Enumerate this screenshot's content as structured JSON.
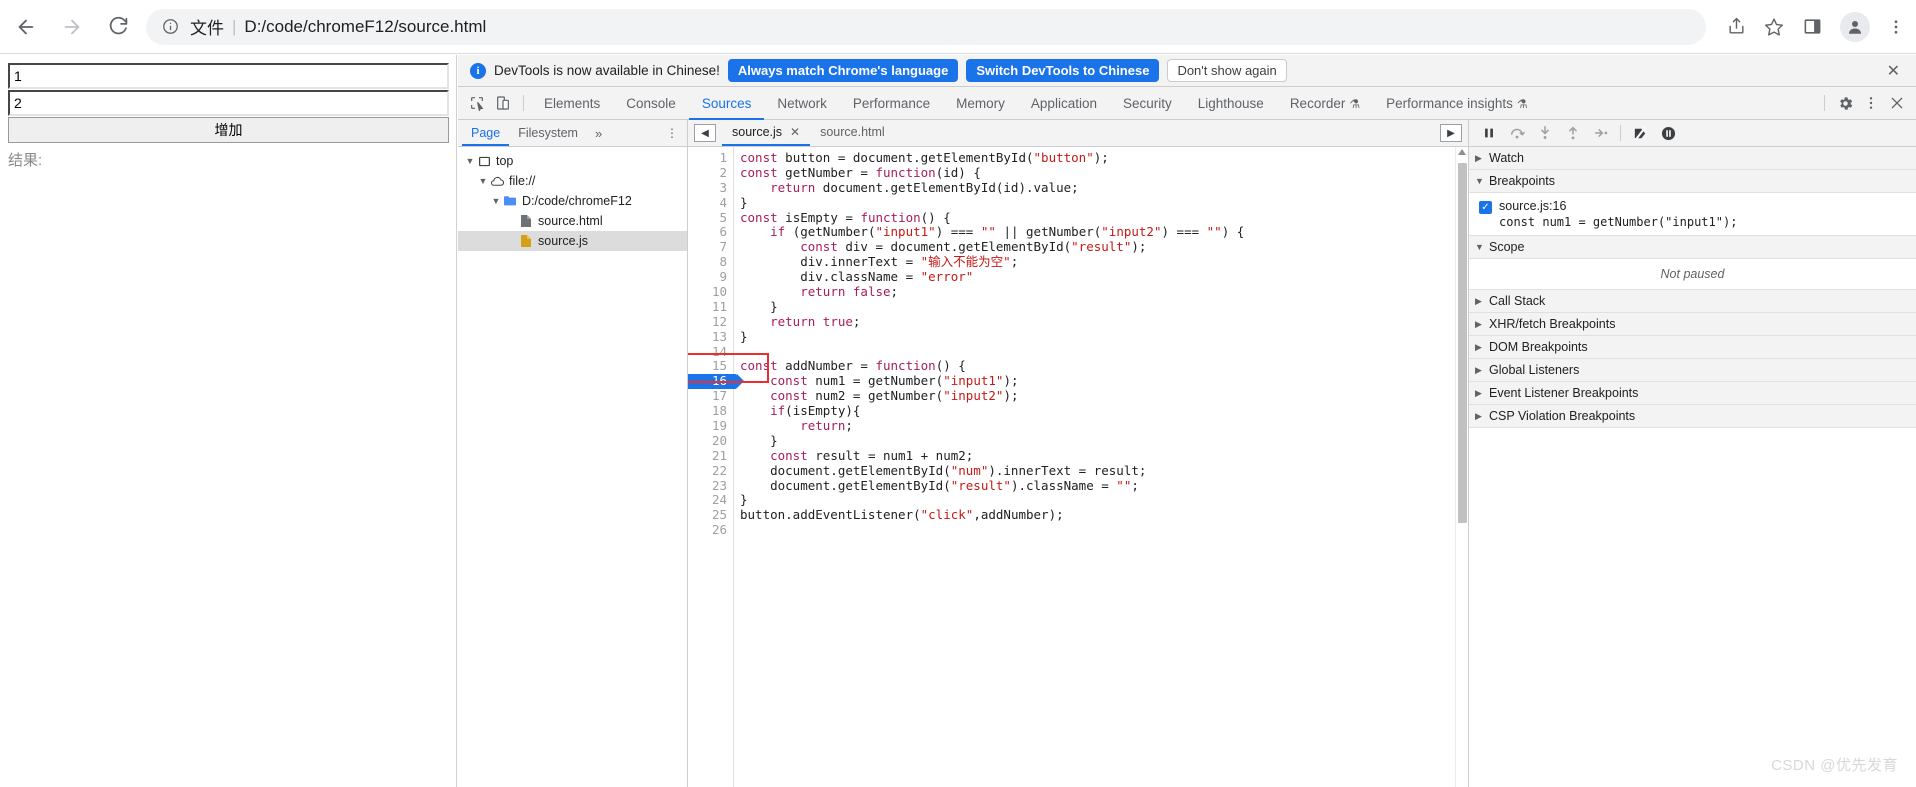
{
  "browser": {
    "nav": {
      "back": "back-arrow",
      "forward": "forward-arrow",
      "reload": "reload"
    },
    "omnibox": {
      "scheme_label": "文件",
      "separator": "|",
      "url": "D:/code/chromeF12/source.html",
      "info_icon": "info-circle-icon"
    },
    "actions": [
      "share-icon",
      "star-icon",
      "sidepanel-icon",
      "profile-avatar",
      "kebab-menu-icon"
    ]
  },
  "page": {
    "input1": {
      "value": "1",
      "placeholder": ""
    },
    "input2": {
      "value": "2",
      "placeholder": ""
    },
    "button_label": "增加",
    "result_label": "结果:",
    "result_value": ""
  },
  "devtools": {
    "banner": {
      "icon": "i",
      "text": "DevTools is now available in Chinese!",
      "primary_1": "Always match Chrome's language",
      "primary_2": "Switch DevTools to Chinese",
      "secondary": "Don't show again",
      "close": "✕"
    },
    "tabs": [
      {
        "label": "Elements",
        "active": false,
        "flask": false
      },
      {
        "label": "Console",
        "active": false,
        "flask": false
      },
      {
        "label": "Sources",
        "active": true,
        "flask": false
      },
      {
        "label": "Network",
        "active": false,
        "flask": false
      },
      {
        "label": "Performance",
        "active": false,
        "flask": false
      },
      {
        "label": "Memory",
        "active": false,
        "flask": false
      },
      {
        "label": "Application",
        "active": false,
        "flask": false
      },
      {
        "label": "Security",
        "active": false,
        "flask": false
      },
      {
        "label": "Lighthouse",
        "active": false,
        "flask": false
      },
      {
        "label": "Recorder",
        "active": false,
        "flask": true
      },
      {
        "label": "Performance insights",
        "active": false,
        "flask": true
      }
    ],
    "tabbar_icons": [
      "inspect-icon",
      "device-toolbar-icon"
    ],
    "tabbar_right_icons": [
      "settings-gear-icon",
      "kebab-menu-icon",
      "close-devtools-icon"
    ],
    "navigator": {
      "tabs": [
        {
          "label": "Page",
          "active": true
        },
        {
          "label": "Filesystem",
          "active": false
        }
      ],
      "more": "»",
      "kebab": "⋮",
      "tree": [
        {
          "label": "top",
          "icon": "frame-icon",
          "depth": 0,
          "expanded": true,
          "selected": false
        },
        {
          "label": "file://",
          "icon": "cloud-icon",
          "depth": 1,
          "expanded": true,
          "selected": false
        },
        {
          "label": "D:/code/chromeF12",
          "icon": "folder-icon",
          "depth": 2,
          "expanded": true,
          "selected": false
        },
        {
          "label": "source.html",
          "icon": "file-html-icon",
          "depth": 3,
          "expanded": null,
          "selected": false
        },
        {
          "label": "source.js",
          "icon": "file-js-icon",
          "depth": 3,
          "expanded": null,
          "selected": true
        }
      ]
    },
    "editor": {
      "collapse_left_icon": "◀",
      "collapse_right_icon": "▶",
      "tabs": [
        {
          "label": "source.js",
          "active": true,
          "closeable": true
        },
        {
          "label": "source.html",
          "active": false,
          "closeable": false
        }
      ],
      "total_lines": 26,
      "breakpoint_line": 16,
      "lines": [
        {
          "n": 1,
          "text": "const button = document.getElementById(\"button\");"
        },
        {
          "n": 2,
          "text": "const getNumber = function(id) {"
        },
        {
          "n": 3,
          "text": "    return document.getElementById(id).value;"
        },
        {
          "n": 4,
          "text": "}"
        },
        {
          "n": 5,
          "text": "const isEmpty = function() {"
        },
        {
          "n": 6,
          "text": "    if (getNumber(\"input1\") === \"\" || getNumber(\"input2\") === \"\") {"
        },
        {
          "n": 7,
          "text": "        const div = document.getElementById(\"result\");"
        },
        {
          "n": 8,
          "text": "        div.innerText = \"输入不能为空\";"
        },
        {
          "n": 9,
          "text": "        div.className = \"error\""
        },
        {
          "n": 10,
          "text": "        return false;"
        },
        {
          "n": 11,
          "text": "    }"
        },
        {
          "n": 12,
          "text": "    return true;"
        },
        {
          "n": 13,
          "text": "}"
        },
        {
          "n": 14,
          "text": ""
        },
        {
          "n": 15,
          "text": "const addNumber = function() {"
        },
        {
          "n": 16,
          "text": "    const num1 = getNumber(\"input1\");"
        },
        {
          "n": 17,
          "text": "    const num2 = getNumber(\"input2\");"
        },
        {
          "n": 18,
          "text": "    if(isEmpty){"
        },
        {
          "n": 19,
          "text": "        return;"
        },
        {
          "n": 20,
          "text": "    }"
        },
        {
          "n": 21,
          "text": "    const result = num1 + num2;"
        },
        {
          "n": 22,
          "text": "    document.getElementById(\"num\").innerText = result;"
        },
        {
          "n": 23,
          "text": "    document.getElementById(\"result\").className = \"\";"
        },
        {
          "n": 24,
          "text": "}"
        },
        {
          "n": 25,
          "text": "button.addEventListener(\"click\",addNumber);"
        },
        {
          "n": 26,
          "text": ""
        }
      ]
    },
    "debugger": {
      "toolbar_icons": [
        "pause-icon",
        "step-over-icon",
        "step-into-icon",
        "step-out-icon",
        "step-icon",
        "deactivate-breakpoints-icon",
        "pause-on-exceptions-icon"
      ],
      "sections": [
        {
          "label": "Watch",
          "expanded": false
        },
        {
          "label": "Breakpoints",
          "expanded": true
        },
        {
          "label": "Scope",
          "expanded": true
        },
        {
          "label": "Call Stack",
          "expanded": false
        },
        {
          "label": "XHR/fetch Breakpoints",
          "expanded": false
        },
        {
          "label": "DOM Breakpoints",
          "expanded": false
        },
        {
          "label": "Global Listeners",
          "expanded": false
        },
        {
          "label": "Event Listener Breakpoints",
          "expanded": false
        },
        {
          "label": "CSP Violation Breakpoints",
          "expanded": false
        }
      ],
      "breakpoint": {
        "checked": true,
        "location": "source.js:16",
        "snippet": "const num1 = getNumber(\"input1\");"
      },
      "scope_status": "Not paused"
    }
  },
  "watermark": "CSDN @优先发育"
}
